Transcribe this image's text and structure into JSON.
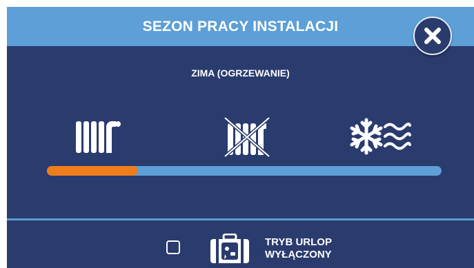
{
  "dialog": {
    "title": "SEZON PRACY INSTALACJI",
    "close_icon": "close-icon"
  },
  "season": {
    "current_label": "ZIMA (OGRZEWANIE)",
    "modes": [
      {
        "id": "heating",
        "icon": "radiator-icon"
      },
      {
        "id": "off",
        "icon": "radiator-crossed-icon"
      },
      {
        "id": "cooling",
        "icon": "snowflake-waves-icon"
      }
    ],
    "slider_position": 0.23
  },
  "vacation": {
    "checked": false,
    "icon": "suitcase-icon",
    "label_line1": "TRYB URLOP",
    "label_line2": "WYŁĄCZONY"
  },
  "colors": {
    "header": "#5d9fd6",
    "background": "#2a3b6e",
    "accent": "#ee7d1b",
    "text": "#ffffff"
  }
}
